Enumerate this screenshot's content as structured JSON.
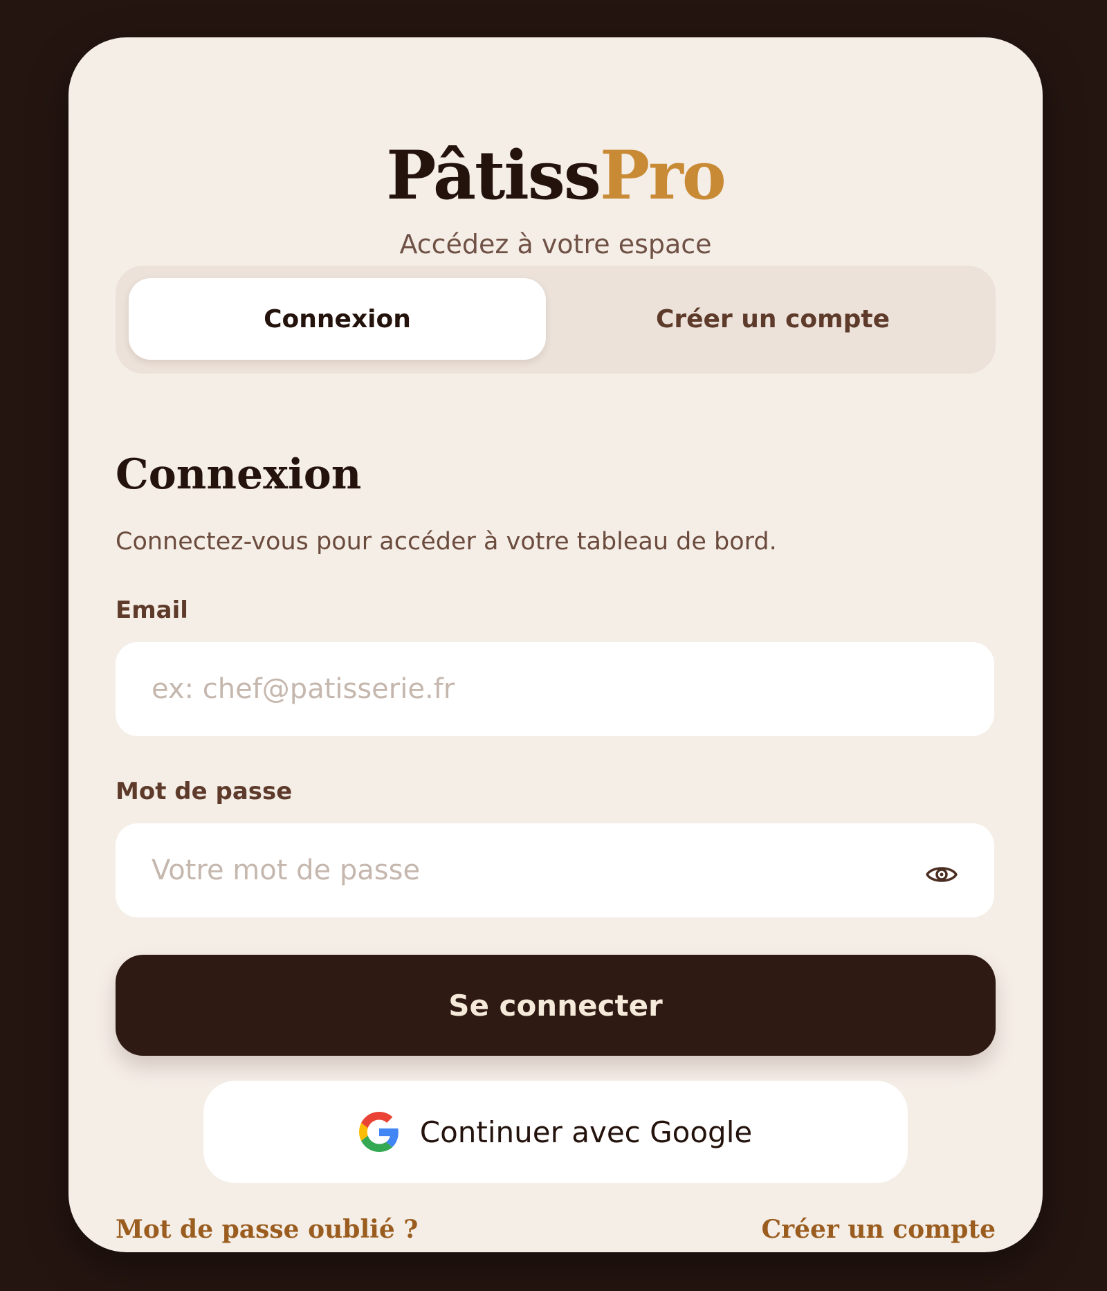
{
  "brand": {
    "name_part1": "Pâtiss",
    "name_part2": "Pro",
    "subtitle": "Accédez à votre espace",
    "colors": {
      "dark": "#24130d",
      "gold": "#c98a35",
      "background": "#241510",
      "card": "#f5eee7",
      "link": "#9a5d1f"
    }
  },
  "tabs": [
    {
      "label": "Connexion",
      "active": true
    },
    {
      "label": "Créer un compte",
      "active": false
    }
  ],
  "form": {
    "heading": "Connexion",
    "description": "Connectez-vous pour accéder à votre tableau de bord.",
    "email": {
      "label": "Email",
      "placeholder": "ex: chef@patisserie.fr",
      "value": ""
    },
    "password": {
      "label": "Mot de passe",
      "placeholder": "Votre mot de passe",
      "value": "",
      "toggle_icon": "eye-icon"
    },
    "submit_label": "Se connecter",
    "google_label": "Continuer avec Google",
    "google_icon": "google-g-icon"
  },
  "footer": {
    "forgot_password": "Mot de passe oublié ?",
    "create_account": "Créer un compte"
  }
}
